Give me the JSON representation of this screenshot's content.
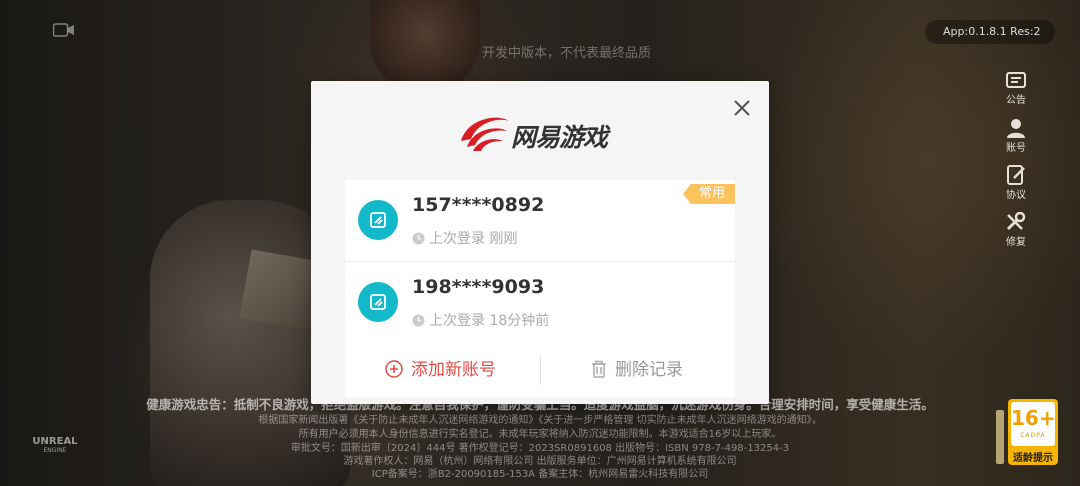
{
  "overlay": {
    "dev_notice": "开发中版本，不代表最终品质",
    "version": "App:0.1.8.1 Res:2"
  },
  "sidebar": {
    "items": [
      {
        "label": "公告",
        "icon": "announcement-icon"
      },
      {
        "label": "账号",
        "icon": "user-icon"
      },
      {
        "label": "协议",
        "icon": "agreement-icon"
      },
      {
        "label": "修复",
        "icon": "repair-icon"
      }
    ]
  },
  "dialog": {
    "brand": "网易游戏",
    "accounts": [
      {
        "phone": "157****0892",
        "last_login": "上次登录 刚刚",
        "tag": "常用"
      },
      {
        "phone": "198****9093",
        "last_login": "上次登录 18分钟前"
      }
    ],
    "add_account": "添加新账号",
    "delete_record": "删除记录"
  },
  "footer": {
    "health_notice": "健康游戏忠告：抵制不良游戏，拒绝盗版游戏。注意自我保护，谨防受骗上当。适度游戏益脑，沉迷游戏伤身。合理安排时间，享受健康生活。",
    "line2": "根据国家新闻出版署《关于防止未成年人沉迷网络游戏的通知》《关于进一步严格管理 切实防止未成年人沉迷网络游戏的通知》，",
    "line3": "所有用户必须用本人身份信息进行实名登记。未成年玩家将纳入防沉迷功能限制。本游戏适合16岁以上玩家。",
    "line4": "审批文号：国新出审〔2024〕444号   著作权登记号：2023SR0891608   出版物号：ISBN 978-7-498-13254-3",
    "line5": "游戏著作权人：网易（杭州）网络有限公司   出版服务单位：广州网易计算机系统有限公司",
    "line6": "ICP备案号：浙B2-20090185-153A   备案主体：杭州网易雷火科技有限公司"
  },
  "engine_logo": {
    "name": "UNREAL",
    "sub": "ENGINE"
  },
  "age_rating": {
    "number": "16+",
    "org": "CADPA",
    "caption": "适龄提示"
  },
  "colors": {
    "accent_red": "#e74a45",
    "teal": "#13b9c9",
    "tag_yellow": "#fcc25d",
    "age_yellow": "#f4b400"
  }
}
